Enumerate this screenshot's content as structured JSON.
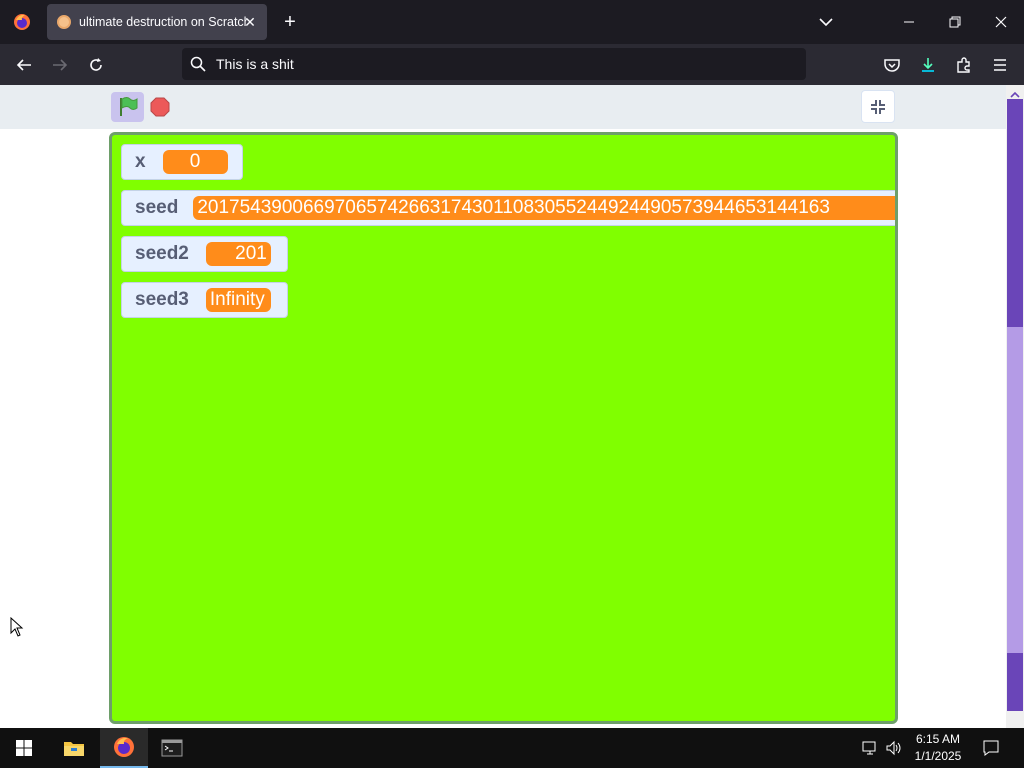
{
  "browser": {
    "tab": {
      "title": "ultimate destruction on Scratch"
    },
    "url": {
      "text": "This is a shit"
    }
  },
  "stage": {
    "background_color": "#80ff00",
    "monitors": [
      {
        "label": "x",
        "value": "0"
      },
      {
        "label": "seed",
        "value": "201754390066970657426631743011083055244924490573944653144163"
      },
      {
        "label": "seed2",
        "value": "201"
      },
      {
        "label": "seed3",
        "value": "Infinity"
      }
    ]
  },
  "taskbar": {
    "time": "6:15 AM",
    "date": "1/1/2025"
  },
  "colors": {
    "accent_orange": "#ff8c1a",
    "stage_green": "#80ff00",
    "chrome_dark": "#1c1b22"
  },
  "icons": [
    "firefox-menu-icon",
    "scratch-favicon-icon",
    "close-icon",
    "plus-icon",
    "chevron-down-icon",
    "minimize-icon",
    "restore-icon",
    "back-arrow-icon",
    "forward-arrow-icon",
    "reload-icon",
    "search-icon",
    "pocket-icon",
    "download-icon",
    "extensions-icon",
    "hamburger-menu-icon",
    "green-flag-icon",
    "stop-icon",
    "exit-fullscreen-icon",
    "windows-start-icon",
    "file-explorer-icon",
    "firefox-icon",
    "terminal-icon",
    "network-icon",
    "volume-icon",
    "notification-icon"
  ]
}
